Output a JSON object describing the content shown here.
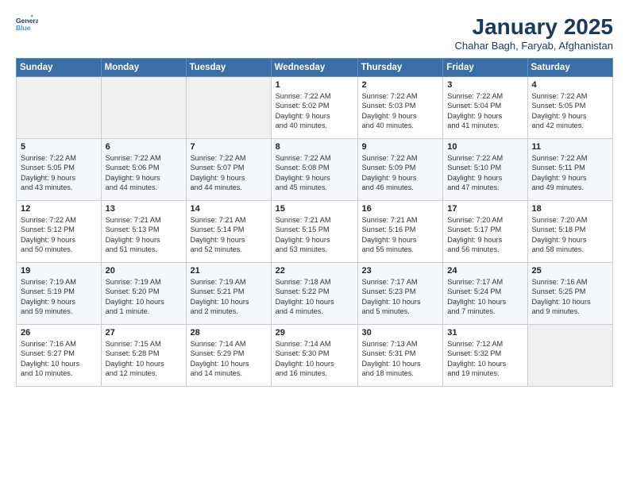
{
  "header": {
    "logo_line1": "General",
    "logo_line2": "Blue",
    "month": "January 2025",
    "location": "Chahar Bagh, Faryab, Afghanistan"
  },
  "weekdays": [
    "Sunday",
    "Monday",
    "Tuesday",
    "Wednesday",
    "Thursday",
    "Friday",
    "Saturday"
  ],
  "weeks": [
    [
      {
        "day": "",
        "info": ""
      },
      {
        "day": "",
        "info": ""
      },
      {
        "day": "",
        "info": ""
      },
      {
        "day": "1",
        "info": "Sunrise: 7:22 AM\nSunset: 5:02 PM\nDaylight: 9 hours\nand 40 minutes."
      },
      {
        "day": "2",
        "info": "Sunrise: 7:22 AM\nSunset: 5:03 PM\nDaylight: 9 hours\nand 40 minutes."
      },
      {
        "day": "3",
        "info": "Sunrise: 7:22 AM\nSunset: 5:04 PM\nDaylight: 9 hours\nand 41 minutes."
      },
      {
        "day": "4",
        "info": "Sunrise: 7:22 AM\nSunset: 5:05 PM\nDaylight: 9 hours\nand 42 minutes."
      }
    ],
    [
      {
        "day": "5",
        "info": "Sunrise: 7:22 AM\nSunset: 5:05 PM\nDaylight: 9 hours\nand 43 minutes."
      },
      {
        "day": "6",
        "info": "Sunrise: 7:22 AM\nSunset: 5:06 PM\nDaylight: 9 hours\nand 44 minutes."
      },
      {
        "day": "7",
        "info": "Sunrise: 7:22 AM\nSunset: 5:07 PM\nDaylight: 9 hours\nand 44 minutes."
      },
      {
        "day": "8",
        "info": "Sunrise: 7:22 AM\nSunset: 5:08 PM\nDaylight: 9 hours\nand 45 minutes."
      },
      {
        "day": "9",
        "info": "Sunrise: 7:22 AM\nSunset: 5:09 PM\nDaylight: 9 hours\nand 46 minutes."
      },
      {
        "day": "10",
        "info": "Sunrise: 7:22 AM\nSunset: 5:10 PM\nDaylight: 9 hours\nand 47 minutes."
      },
      {
        "day": "11",
        "info": "Sunrise: 7:22 AM\nSunset: 5:11 PM\nDaylight: 9 hours\nand 49 minutes."
      }
    ],
    [
      {
        "day": "12",
        "info": "Sunrise: 7:22 AM\nSunset: 5:12 PM\nDaylight: 9 hours\nand 50 minutes."
      },
      {
        "day": "13",
        "info": "Sunrise: 7:21 AM\nSunset: 5:13 PM\nDaylight: 9 hours\nand 51 minutes."
      },
      {
        "day": "14",
        "info": "Sunrise: 7:21 AM\nSunset: 5:14 PM\nDaylight: 9 hours\nand 52 minutes."
      },
      {
        "day": "15",
        "info": "Sunrise: 7:21 AM\nSunset: 5:15 PM\nDaylight: 9 hours\nand 53 minutes."
      },
      {
        "day": "16",
        "info": "Sunrise: 7:21 AM\nSunset: 5:16 PM\nDaylight: 9 hours\nand 55 minutes."
      },
      {
        "day": "17",
        "info": "Sunrise: 7:20 AM\nSunset: 5:17 PM\nDaylight: 9 hours\nand 56 minutes."
      },
      {
        "day": "18",
        "info": "Sunrise: 7:20 AM\nSunset: 5:18 PM\nDaylight: 9 hours\nand 58 minutes."
      }
    ],
    [
      {
        "day": "19",
        "info": "Sunrise: 7:19 AM\nSunset: 5:19 PM\nDaylight: 9 hours\nand 59 minutes."
      },
      {
        "day": "20",
        "info": "Sunrise: 7:19 AM\nSunset: 5:20 PM\nDaylight: 10 hours\nand 1 minute."
      },
      {
        "day": "21",
        "info": "Sunrise: 7:19 AM\nSunset: 5:21 PM\nDaylight: 10 hours\nand 2 minutes."
      },
      {
        "day": "22",
        "info": "Sunrise: 7:18 AM\nSunset: 5:22 PM\nDaylight: 10 hours\nand 4 minutes."
      },
      {
        "day": "23",
        "info": "Sunrise: 7:17 AM\nSunset: 5:23 PM\nDaylight: 10 hours\nand 5 minutes."
      },
      {
        "day": "24",
        "info": "Sunrise: 7:17 AM\nSunset: 5:24 PM\nDaylight: 10 hours\nand 7 minutes."
      },
      {
        "day": "25",
        "info": "Sunrise: 7:16 AM\nSunset: 5:25 PM\nDaylight: 10 hours\nand 9 minutes."
      }
    ],
    [
      {
        "day": "26",
        "info": "Sunrise: 7:16 AM\nSunset: 5:27 PM\nDaylight: 10 hours\nand 10 minutes."
      },
      {
        "day": "27",
        "info": "Sunrise: 7:15 AM\nSunset: 5:28 PM\nDaylight: 10 hours\nand 12 minutes."
      },
      {
        "day": "28",
        "info": "Sunrise: 7:14 AM\nSunset: 5:29 PM\nDaylight: 10 hours\nand 14 minutes."
      },
      {
        "day": "29",
        "info": "Sunrise: 7:14 AM\nSunset: 5:30 PM\nDaylight: 10 hours\nand 16 minutes."
      },
      {
        "day": "30",
        "info": "Sunrise: 7:13 AM\nSunset: 5:31 PM\nDaylight: 10 hours\nand 18 minutes."
      },
      {
        "day": "31",
        "info": "Sunrise: 7:12 AM\nSunset: 5:32 PM\nDaylight: 10 hours\nand 19 minutes."
      },
      {
        "day": "",
        "info": ""
      }
    ]
  ]
}
